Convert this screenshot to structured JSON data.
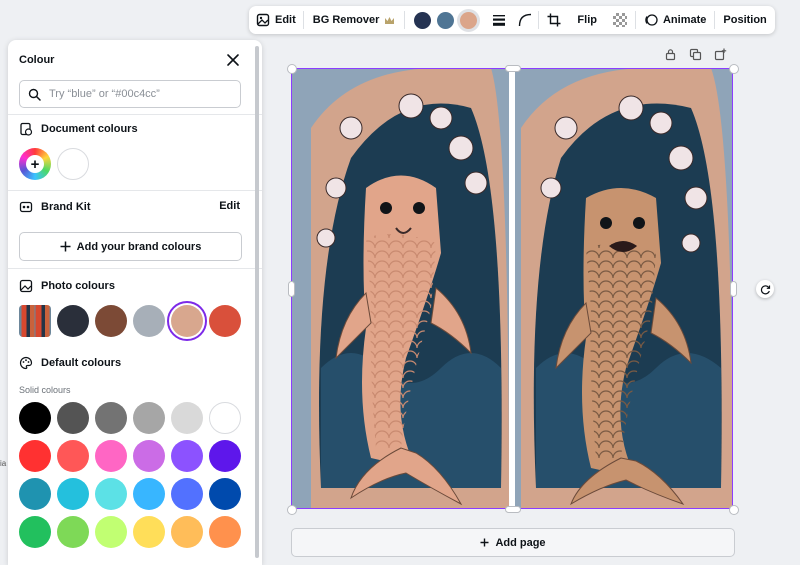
{
  "toolbar": {
    "edit_label": "Edit",
    "bg_remover_label": "BG Remover",
    "swatches": [
      "#253352",
      "#4f7594",
      "#dba58a"
    ],
    "flip_label": "Flip",
    "animate_label": "Animate",
    "position_label": "Position"
  },
  "panel": {
    "title": "Colour",
    "search_placeholder": "Try “blue” or “#00c4cc”",
    "document_colours": {
      "title": "Document colours",
      "swatches": [
        "#ffffff"
      ]
    },
    "brand_kit": {
      "title": "Brand Kit",
      "edit_label": "Edit",
      "add_button_label": "Add your brand colours"
    },
    "photo_colours": {
      "title": "Photo colours",
      "swatches": [
        "#2a2f3a",
        "#7c4a36",
        "#a7afb8",
        "#d8a78e",
        "#d9503b"
      ],
      "selected": "#d8a78e"
    },
    "default_colours": {
      "title": "Default colours",
      "solid_label": "Solid colours",
      "rows": [
        [
          "#000000",
          "#545454",
          "#737373",
          "#a6a6a6",
          "#d9d9d9",
          "#ffffff"
        ],
        [
          "#ff3131",
          "#ff5757",
          "#ff66c4",
          "#cb6ce6",
          "#8c52ff",
          "#5e17eb"
        ],
        [
          "#1f93b0",
          "#24c0dd",
          "#5ce1e6",
          "#38b6ff",
          "#5271ff",
          "#004aad"
        ],
        [
          "#22c05e",
          "#7ed957",
          "#c1ff72",
          "#ffde59",
          "#ffbd59",
          "#ff914d"
        ]
      ]
    }
  },
  "canvas": {
    "add_page_label": "Add page"
  },
  "edge_text": "ia"
}
